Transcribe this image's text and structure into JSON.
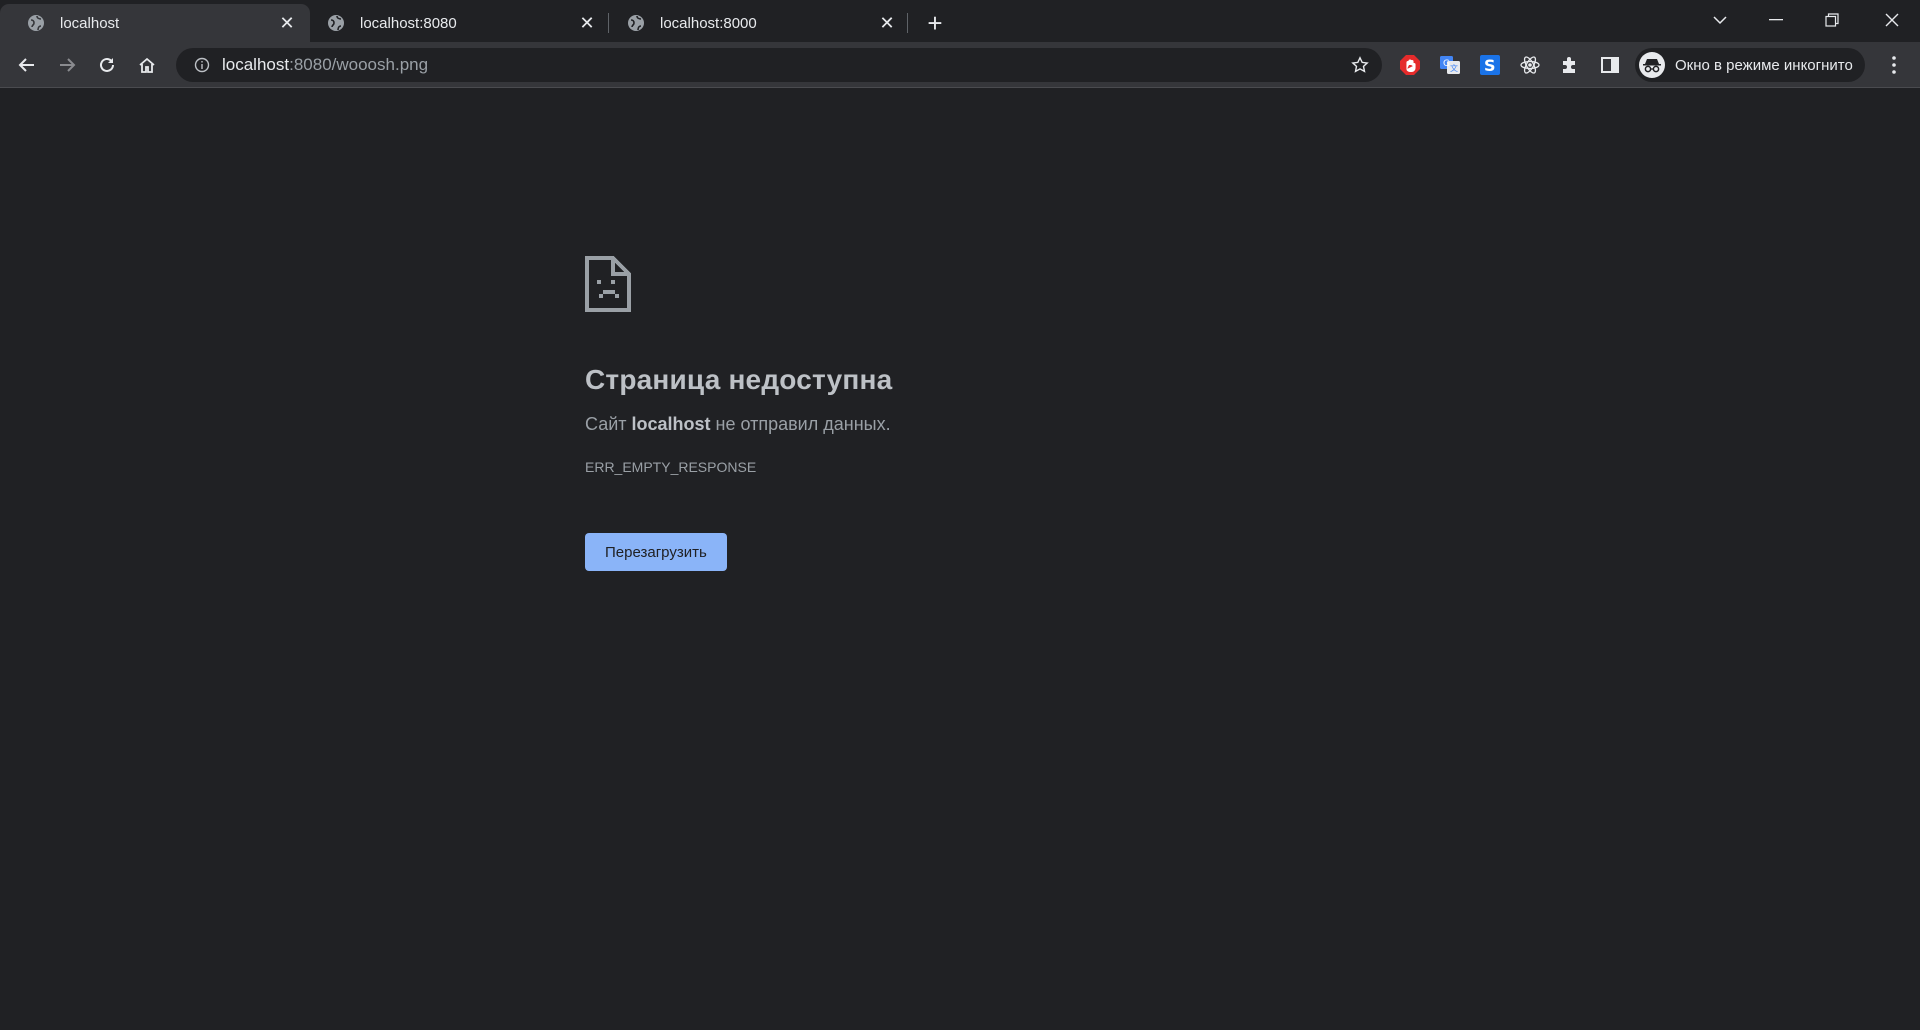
{
  "tabs": [
    {
      "title": "localhost",
      "active": true
    },
    {
      "title": "localhost:8080",
      "active": false
    },
    {
      "title": "localhost:8000",
      "active": false
    }
  ],
  "new_tab_label": "+",
  "omnibox": {
    "host": "localhost",
    "rest": ":8080/wooosh.png"
  },
  "extensions": [
    "adblock-icon",
    "google-translate-icon",
    "s-extension-icon",
    "react-devtools-icon",
    "extensions-puzzle-icon",
    "side-panel-icon"
  ],
  "incognito": {
    "label": "Окно в режиме инкогнито"
  },
  "error": {
    "title": "Страница недоступна",
    "desc_prefix": "Сайт ",
    "desc_host": "localhost",
    "desc_suffix": " не отправил данных.",
    "code": "ERR_EMPTY_RESPONSE",
    "reload_label": "Перезагрузить"
  },
  "colors": {
    "background": "#202124",
    "toolbar": "#35363a",
    "accent_button": "#8ab4f8",
    "adblock_red": "#e52b2b",
    "translate_blue": "#4285f4"
  }
}
